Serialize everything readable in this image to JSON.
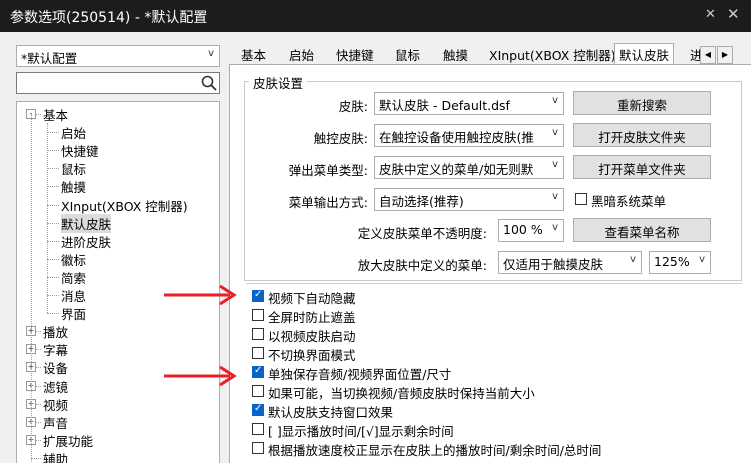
{
  "window": {
    "title": "参数选项(250514) - *默认配置"
  },
  "profile_combo": "*默认配置",
  "tree": {
    "items": [
      {
        "label": "基本",
        "level": 0,
        "expander": "-"
      },
      {
        "label": "启始",
        "level": 1
      },
      {
        "label": "快捷键",
        "level": 1
      },
      {
        "label": "鼠标",
        "level": 1
      },
      {
        "label": "触摸",
        "level": 1
      },
      {
        "label": "XInput(XBOX 控制器)",
        "level": 1
      },
      {
        "label": "默认皮肤",
        "level": 1,
        "selected": true
      },
      {
        "label": "进阶皮肤",
        "level": 1
      },
      {
        "label": "徽标",
        "level": 1
      },
      {
        "label": "简索",
        "level": 1
      },
      {
        "label": "消息",
        "level": 1
      },
      {
        "label": "界面",
        "level": 1
      },
      {
        "label": "播放",
        "level": 0,
        "expander": "+"
      },
      {
        "label": "字幕",
        "level": 0,
        "expander": "+"
      },
      {
        "label": "设备",
        "level": 0,
        "expander": "+"
      },
      {
        "label": "滤镜",
        "level": 0,
        "expander": "+"
      },
      {
        "label": "视频",
        "level": 0,
        "expander": "+"
      },
      {
        "label": "声音",
        "level": 0,
        "expander": "+"
      },
      {
        "label": "扩展功能",
        "level": 0,
        "expander": "+"
      },
      {
        "label": "辅助",
        "level": 0
      }
    ]
  },
  "tabs": [
    {
      "label": "基本"
    },
    {
      "label": "启始"
    },
    {
      "label": "快捷键"
    },
    {
      "label": "鼠标"
    },
    {
      "label": "触摸"
    },
    {
      "label": "XInput(XBOX 控制器)"
    },
    {
      "label": "默认皮肤",
      "active": true
    },
    {
      "label": "进"
    }
  ],
  "group": {
    "title": "皮肤设置",
    "skin_label": "皮肤:",
    "skin_value": "默认皮肤 - Default.dsf",
    "refresh_button": "重新搜索",
    "touch_skin_label": "触控皮肤:",
    "touch_skin_value": "在触控设备使用触控皮肤(推",
    "open_skin_folder_button": "打开皮肤文件夹",
    "popup_menu_type_label": "弹出菜单类型:",
    "popup_menu_type_value": "皮肤中定义的菜单/如无则默",
    "open_menu_folder_button": "打开菜单文件夹",
    "menu_output_label": "菜单输出方式:",
    "menu_output_value": "自动选择(推荐)",
    "dark_menu_checkbox": "黑暗系统菜单",
    "opacity_label": "定义皮肤菜单不透明度:",
    "opacity_value": "100 %",
    "view_menu_names_button": "查看菜单名称",
    "zoom_menu_label": "放大皮肤中定义的菜单:",
    "zoom_menu_value": "仅适用于触摸皮肤",
    "zoom_percent_value": "125%"
  },
  "checkboxes": [
    {
      "label": "视频下自动隐藏",
      "checked": true
    },
    {
      "label": "全屏时防止遮盖",
      "checked": false
    },
    {
      "label": "以视频皮肤启动",
      "checked": false
    },
    {
      "label": "不切换界面模式",
      "checked": false
    },
    {
      "label": "单独保存音频/视频界面位置/尺寸",
      "checked": true
    },
    {
      "label": "如果可能，当切换视频/音频皮肤时保持当前大小",
      "checked": false
    },
    {
      "label": "默认皮肤支持窗口效果",
      "checked": true
    },
    {
      "label": "[ ]显示播放时间/[√]显示剩余时间",
      "checked": false
    },
    {
      "label": "根据播放速度校正显示在皮肤上的播放时间/剩余时间/总时间",
      "checked": false
    }
  ],
  "colors": {
    "arrow": "#e8202a",
    "check_accent": "#0a64c8",
    "titlebar": "#1c1c1c"
  }
}
